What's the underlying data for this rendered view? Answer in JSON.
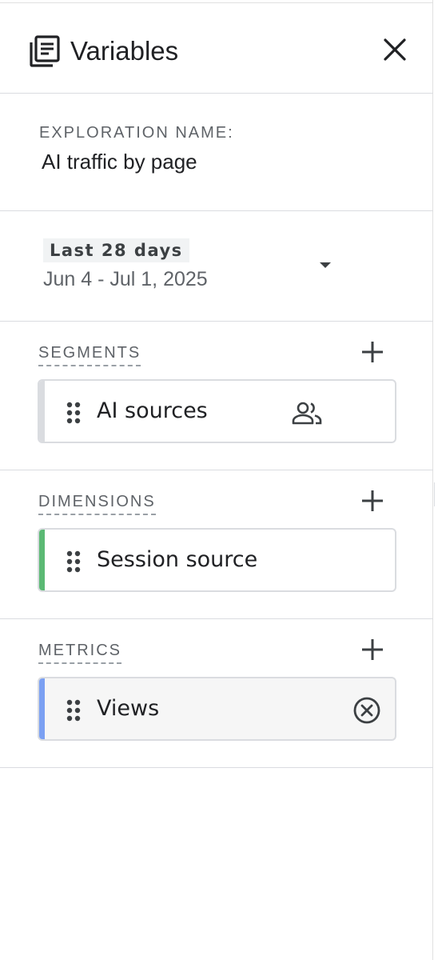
{
  "header": {
    "title": "Variables",
    "icon": "list-document-icon",
    "close_icon": "close-icon"
  },
  "exploration": {
    "label": "EXPLORATION NAME:",
    "value": "AI traffic by page"
  },
  "date_range": {
    "preset": "Last 28 days",
    "range": "Jun 4 - Jul 1, 2025",
    "dropdown_icon": "caret-down-icon"
  },
  "segments": {
    "title": "SEGMENTS",
    "add_icon": "plus-icon",
    "items": [
      {
        "label": "AI sources",
        "icon": "people-icon",
        "accent": "#dadce0"
      }
    ]
  },
  "dimensions": {
    "title": "DIMENSIONS",
    "add_icon": "plus-icon",
    "items": [
      {
        "label": "Session source",
        "accent": "#5bb974"
      }
    ]
  },
  "metrics": {
    "title": "METRICS",
    "add_icon": "plus-icon",
    "items": [
      {
        "label": "Views",
        "icon": "remove-circle-icon",
        "accent": "#7ba0f2"
      }
    ]
  },
  "colors": {
    "text_primary": "#202124",
    "text_secondary": "#5f6368",
    "divider": "#dadce0"
  }
}
